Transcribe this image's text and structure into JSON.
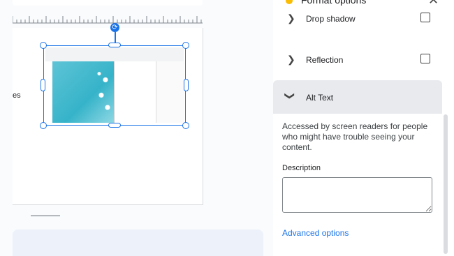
{
  "canvas": {
    "partial_text": "es"
  },
  "panel": {
    "title": "Format options",
    "sections": {
      "drop_shadow": "Drop shadow",
      "reflection": "Reflection",
      "alt_text": "Alt Text"
    },
    "alt_text": {
      "description_intro": "Accessed by screen readers for people who might have trouble seeing your content.",
      "description_label": "Description",
      "description_value": "",
      "advanced_options": "Advanced options"
    }
  },
  "icons": {
    "collapse": "chevron-right-icon",
    "expand": "chevron-down-icon",
    "close": "close-icon",
    "rotate": "rotate-icon"
  },
  "colors": {
    "selection": "#1a73e8",
    "link": "#1a73e8",
    "section_header": "#e8eaed"
  }
}
